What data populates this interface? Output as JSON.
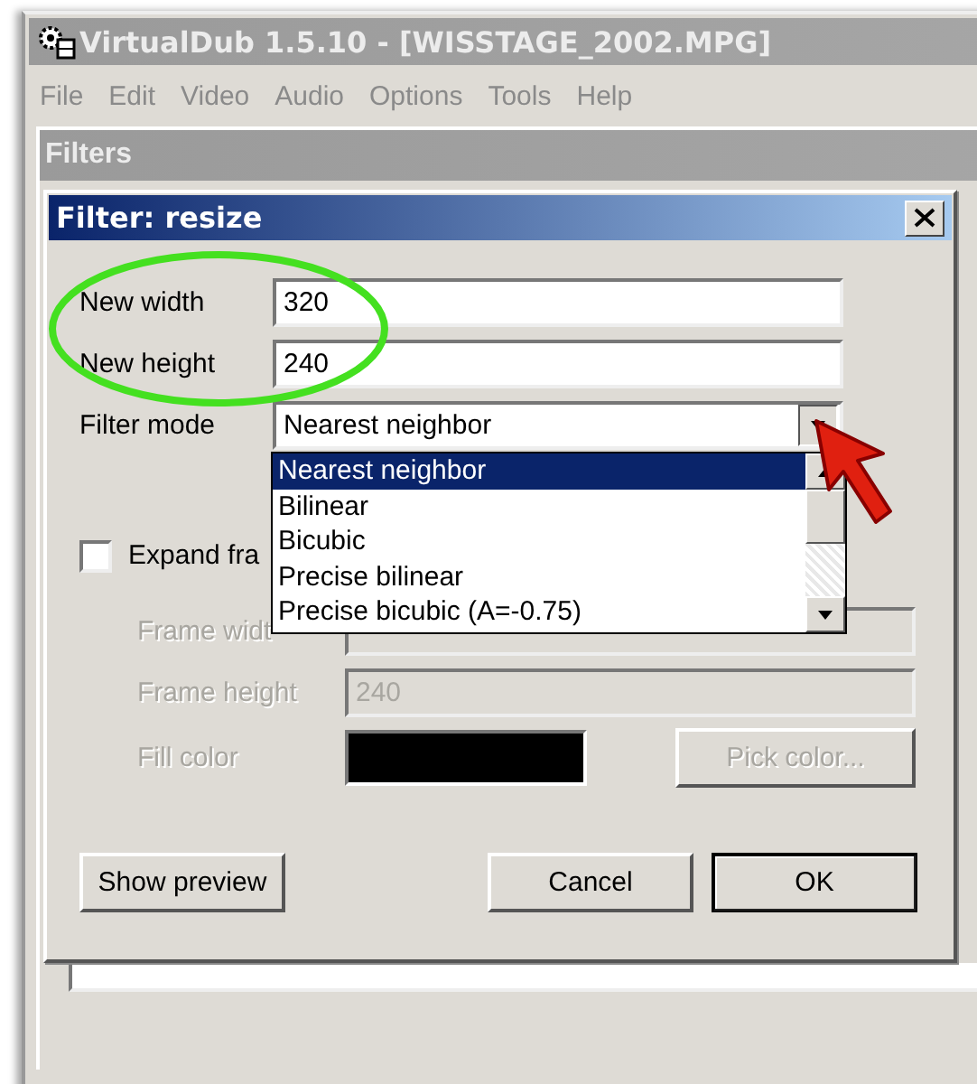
{
  "window": {
    "title": "VirtualDub 1.5.10 - [WISSTAGE_2002.MPG]",
    "active": false
  },
  "menu": [
    "File",
    "Edit",
    "Video",
    "Audio",
    "Options",
    "Tools",
    "Help"
  ],
  "filters_window": {
    "title": "Filters",
    "active": false
  },
  "dialog": {
    "title": "Filter: resize",
    "active": true,
    "fields": [
      {
        "label": "New width",
        "value": "320"
      },
      {
        "label": "New height",
        "value": "240"
      }
    ],
    "filter_mode": {
      "label": "Filter mode",
      "value": "Nearest neighbor",
      "expanded": true,
      "options": [
        {
          "label": "Nearest neighbor",
          "selected": true
        },
        {
          "label": "Bilinear",
          "selected": false
        },
        {
          "label": "Bicubic",
          "selected": false
        },
        {
          "label": "Precise bilinear",
          "selected": false
        },
        {
          "label": "Precise bicubic (A=-0.75)",
          "selected": false
        }
      ]
    },
    "expand_frame": {
      "label": "Expand fra",
      "checked": false
    },
    "frame_fields": [
      {
        "label": "Frame widt",
        "disabled": true
      },
      {
        "label": "Frame height",
        "value": "240",
        "disabled": true
      }
    ],
    "fill_color": {
      "label": "Fill color",
      "color": "#000000",
      "disabled": true
    },
    "pick_color": {
      "label": "Pick color...",
      "disabled": true
    },
    "buttons": [
      {
        "label": "Show preview",
        "default": false
      },
      {
        "label": "Cancel",
        "default": false
      },
      {
        "label": "OK",
        "default": true
      }
    ]
  }
}
